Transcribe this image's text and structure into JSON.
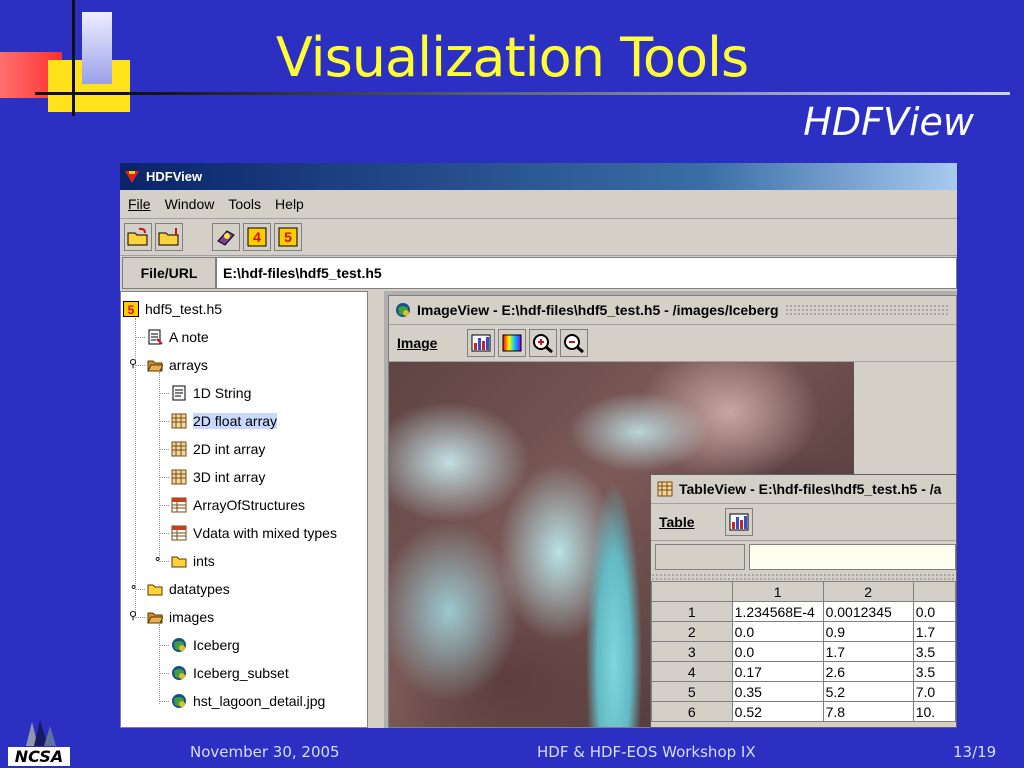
{
  "slide": {
    "title": "Visualization Tools",
    "subtitle": "HDFView",
    "footer": {
      "date": "November 30, 2005",
      "event": "HDF & HDF-EOS Workshop IX",
      "page": "13/19"
    },
    "logo_text": "NCSA"
  },
  "app": {
    "title": "HDFView",
    "menu": [
      "File",
      "Window",
      "Tools",
      "Help"
    ],
    "toolbar_icons": [
      "open-folder-icon",
      "close-folder-icon",
      "help-book-icon",
      "hdf4-icon",
      "hdf5-icon"
    ],
    "toolbar_glyphs": {
      "hdf4": "4",
      "hdf5": "5"
    },
    "url_label": "File/URL",
    "url_value": "E:\\hdf-files\\hdf5_test.h5"
  },
  "tree": {
    "root": "hdf5_test.h5",
    "root_glyph": "5",
    "items": [
      {
        "label": "A note",
        "icon": "note-icon"
      },
      {
        "label": "arrays",
        "icon": "folder-open-icon"
      },
      {
        "label": "1D String",
        "icon": "text-doc-icon"
      },
      {
        "label": "2D float array",
        "icon": "dataset-icon",
        "selected": true
      },
      {
        "label": "2D int array",
        "icon": "dataset-icon"
      },
      {
        "label": "3D int array",
        "icon": "dataset-icon"
      },
      {
        "label": "ArrayOfStructures",
        "icon": "table-icon"
      },
      {
        "label": "Vdata with mixed types",
        "icon": "table-icon"
      },
      {
        "label": "ints",
        "icon": "folder-icon"
      },
      {
        "label": "datatypes",
        "icon": "folder-icon"
      },
      {
        "label": "images",
        "icon": "folder-open-icon"
      },
      {
        "label": "Iceberg",
        "icon": "image-icon"
      },
      {
        "label": "Iceberg_subset",
        "icon": "image-icon"
      },
      {
        "label": "hst_lagoon_detail.jpg",
        "icon": "image-icon"
      }
    ],
    "expanders": {
      "expanded": "⚲",
      "collapsed": "⚬"
    }
  },
  "imageview": {
    "title": "ImageView - E:\\hdf-files\\hdf5_test.h5 - /images/Iceberg",
    "menu": "Image",
    "tools": [
      "histogram-icon",
      "palette-icon",
      "zoom-in-icon",
      "zoom-out-icon"
    ]
  },
  "tableview": {
    "title": "TableView - E:\\hdf-files\\hdf5_test.h5 - /a",
    "menu": "Table",
    "columns": [
      "1",
      "2",
      ""
    ],
    "rows": [
      {
        "idx": "1",
        "c1": "1.234568E-4",
        "c2": "0.0012345",
        "c3": "0.0"
      },
      {
        "idx": "2",
        "c1": "0.0",
        "c2": "0.9",
        "c3": "1.7"
      },
      {
        "idx": "3",
        "c1": "0.0",
        "c2": "1.7",
        "c3": "3.5"
      },
      {
        "idx": "4",
        "c1": "0.17",
        "c2": "2.6",
        "c3": "3.5"
      },
      {
        "idx": "5",
        "c1": "0.35",
        "c2": "5.2",
        "c3": "7.0"
      },
      {
        "idx": "6",
        "c1": "0.52",
        "c2": "7.8",
        "c3": "10."
      }
    ]
  },
  "colors": {
    "background": "#2b2fc2",
    "title": "#ffff33",
    "subtitle": "#ffffff"
  }
}
